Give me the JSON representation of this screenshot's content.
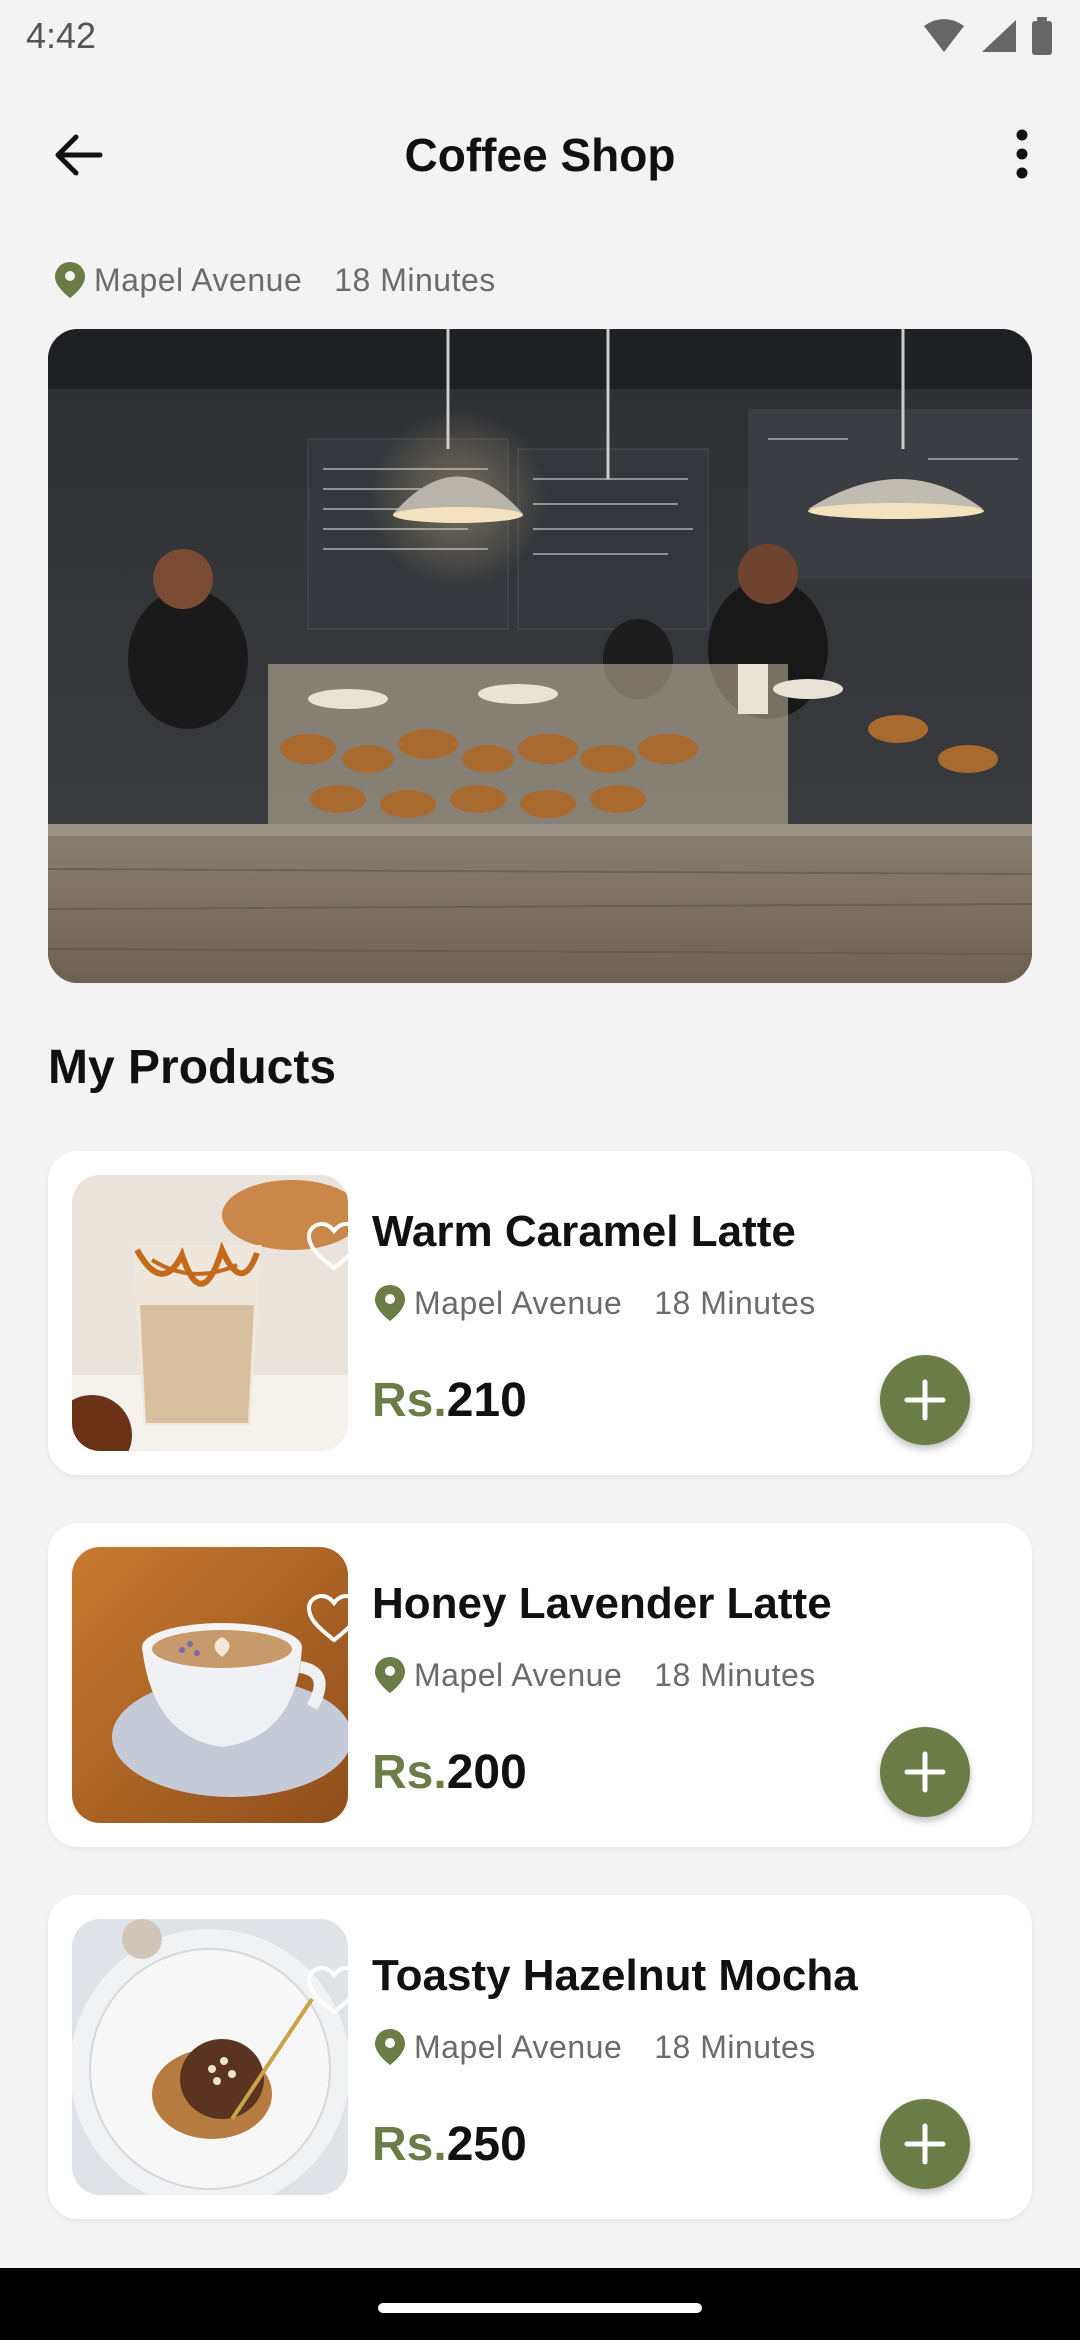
{
  "status": {
    "time": "4:42"
  },
  "header": {
    "title": "Coffee Shop"
  },
  "shop": {
    "location": "Mapel Avenue",
    "time": "18 Minutes"
  },
  "section": {
    "title": "My Products"
  },
  "products": [
    {
      "name": "Warm Caramel Latte",
      "location": "Mapel Avenue",
      "time": "18 Minutes",
      "currency": "Rs.",
      "price": "210"
    },
    {
      "name": "Honey Lavender Latte",
      "location": "Mapel Avenue",
      "time": "18 Minutes",
      "currency": "Rs.",
      "price": "200"
    },
    {
      "name": "Toasty Hazelnut Mocha",
      "location": "Mapel Avenue",
      "time": "18 Minutes",
      "currency": "Rs.",
      "price": "250"
    }
  ],
  "colors": {
    "accent": "#6b7c47",
    "pin": "#6b7c47",
    "navbar": "#000000"
  },
  "icons": [
    "back-arrow-icon",
    "more-vert-icon",
    "location-pin-icon",
    "heart-outline-icon",
    "plus-icon"
  ]
}
